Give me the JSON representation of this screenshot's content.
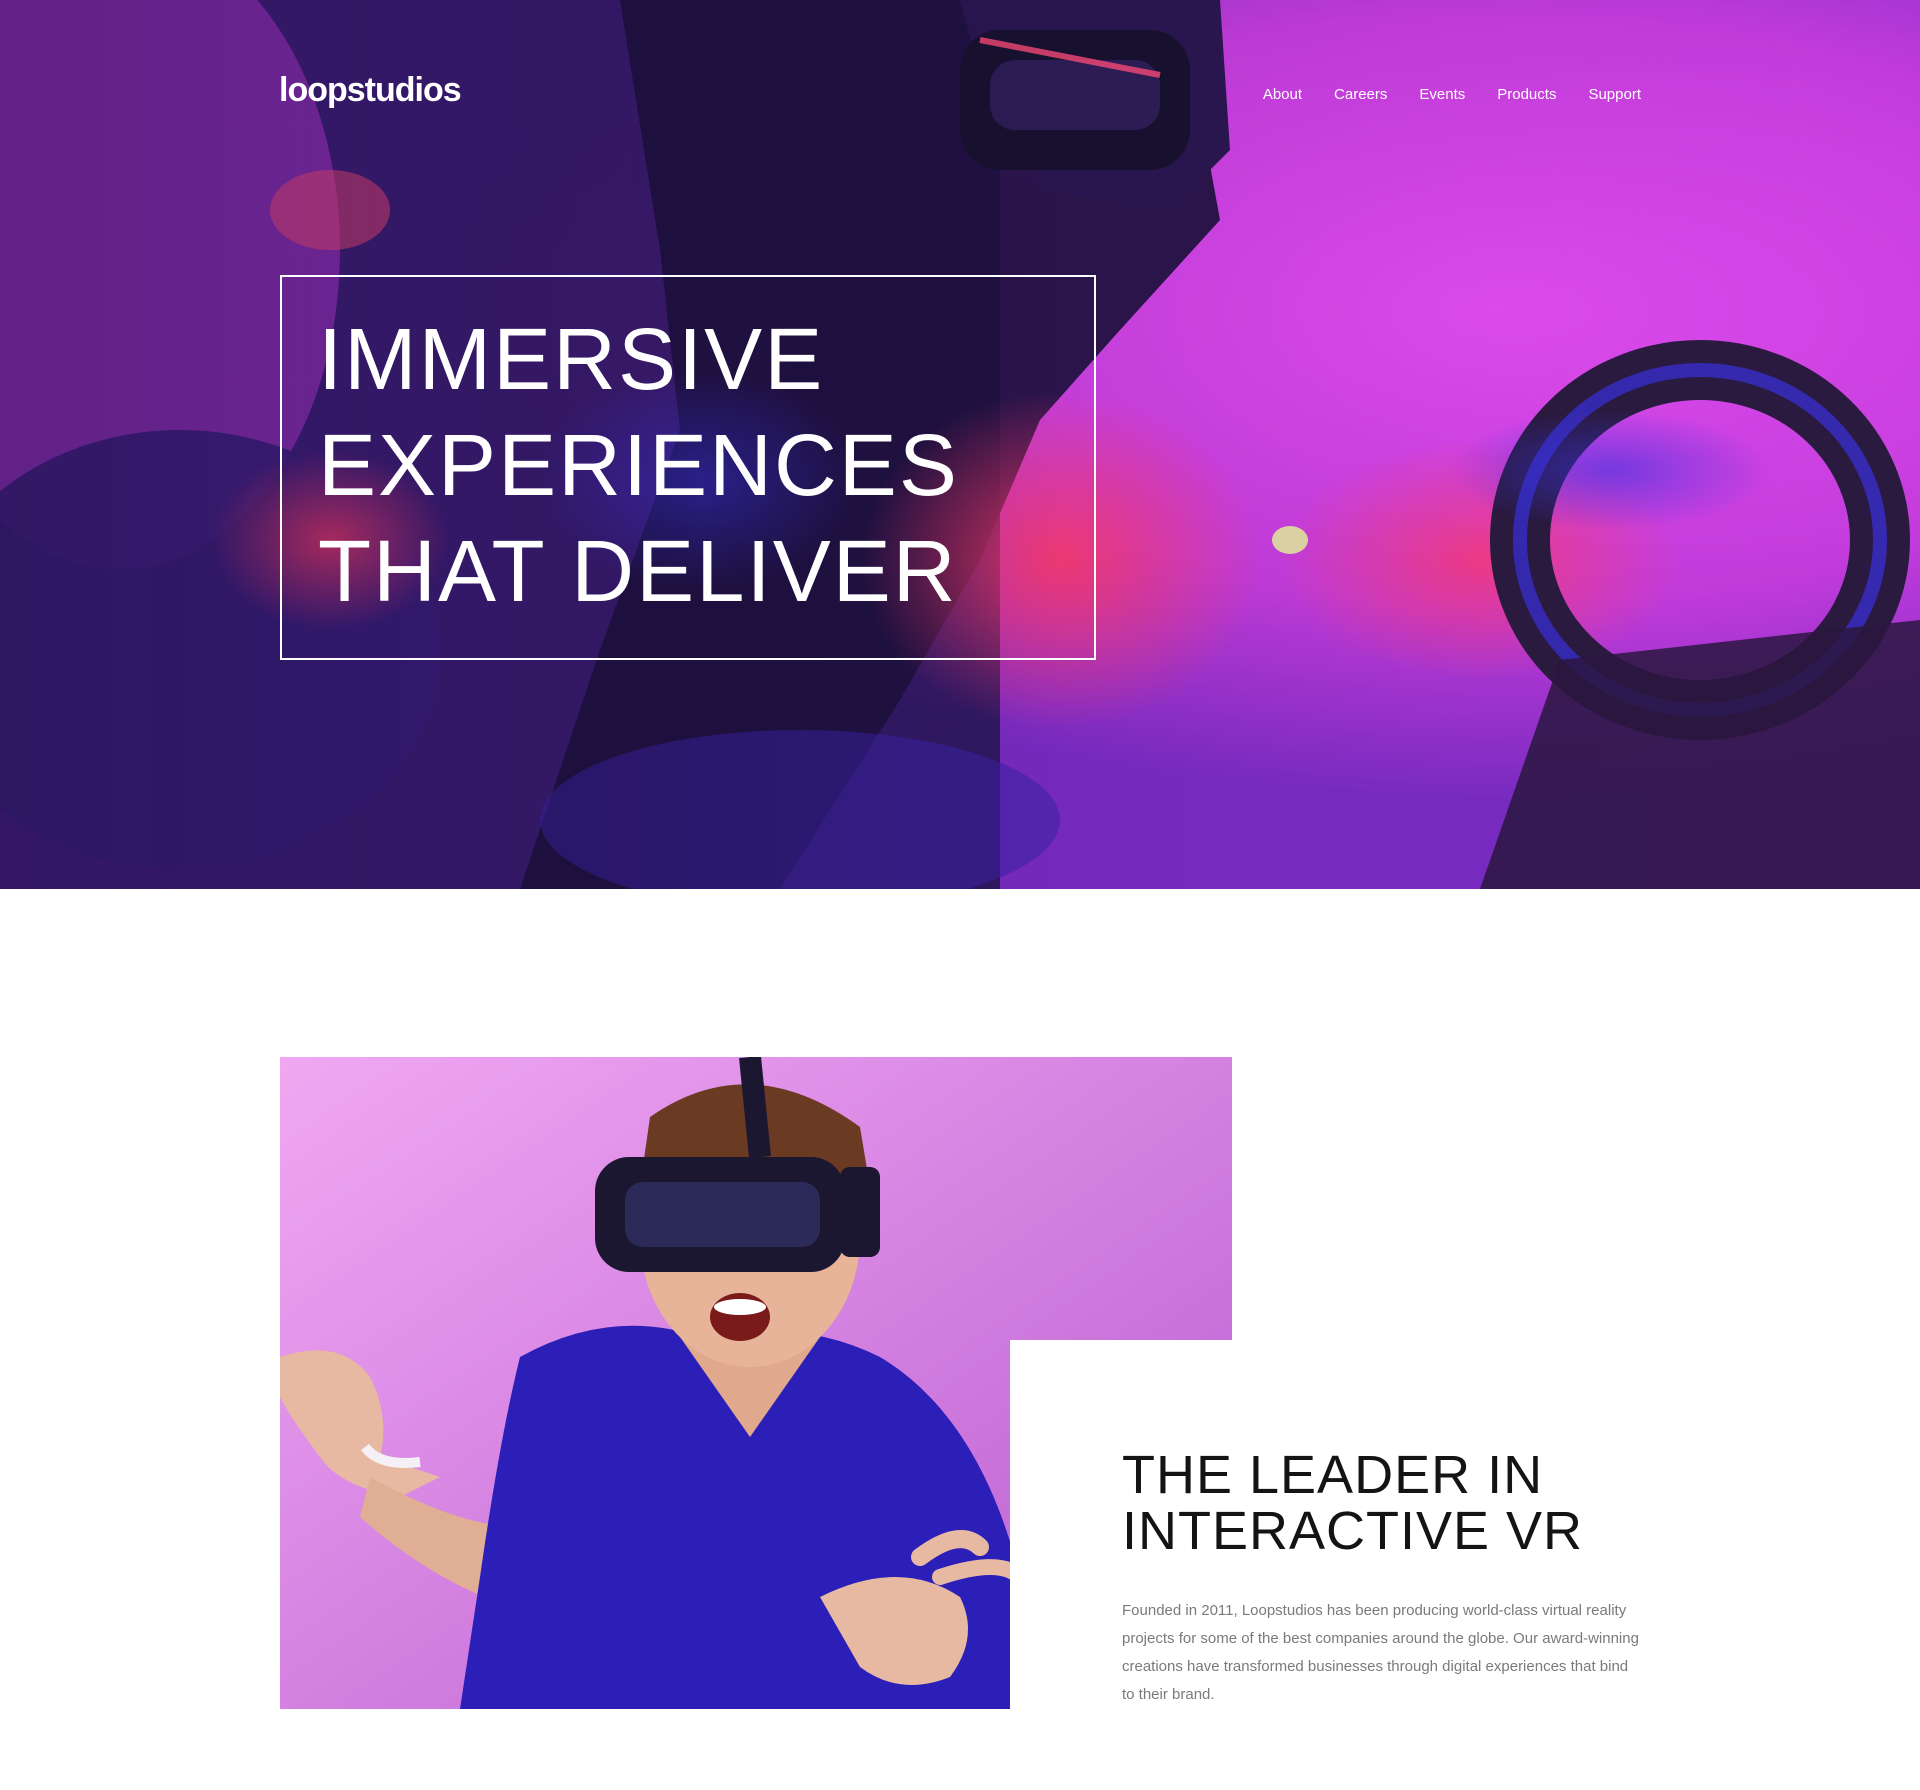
{
  "brand": {
    "logo_text": "loopstudios"
  },
  "nav": {
    "items": [
      {
        "label": "About"
      },
      {
        "label": "Careers"
      },
      {
        "label": "Events"
      },
      {
        "label": "Products"
      },
      {
        "label": "Support"
      }
    ]
  },
  "hero": {
    "title_lines": [
      "IMMERSIVE",
      "EXPERIENCES",
      "THAT DELIVER"
    ]
  },
  "about": {
    "title_lines": [
      "THE LEADER IN",
      "INTERACTIVE VR"
    ],
    "body": "Founded in 2011, Loopstudios has been producing world-class virtual reality projects for some of the best companies around the globe. Our award-winning creations have transformed businesses through digital experiences that bind to their brand."
  },
  "colors": {
    "hero_magenta": "#d43fe0",
    "hero_blue": "#3c2ad6",
    "hero_red": "#f0306a",
    "about_bg_pink": "#e9a1ee",
    "shirt_blue": "#2a1fb8",
    "title_dark": "#141414",
    "body_gray": "#7a7a7a"
  }
}
